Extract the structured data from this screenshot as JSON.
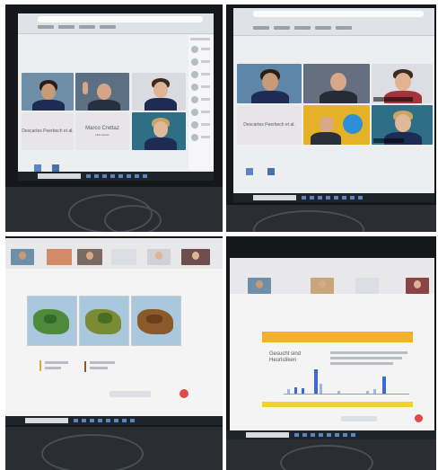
{
  "photo_top_left": {
    "participants": [
      {
        "label": "Descartes Peerbech et al."
      },
      {
        "label": "Marco Crettaz",
        "sub": "Hub Center"
      }
    ]
  },
  "photo_top_right": {
    "participants": [
      {
        "label": "Descartes Peerbech et al."
      }
    ]
  },
  "photo_bottom_right": {
    "slide_title_line1": "Gesucht sind",
    "slide_title_line2": "Heuristiken"
  },
  "colors": {
    "monitor_bezel": "#15171a",
    "meeting_bg": "#eceef0",
    "slide_orange": "#f2b231",
    "chart_blue": "#3c6bd0",
    "record_red": "#e24848"
  }
}
